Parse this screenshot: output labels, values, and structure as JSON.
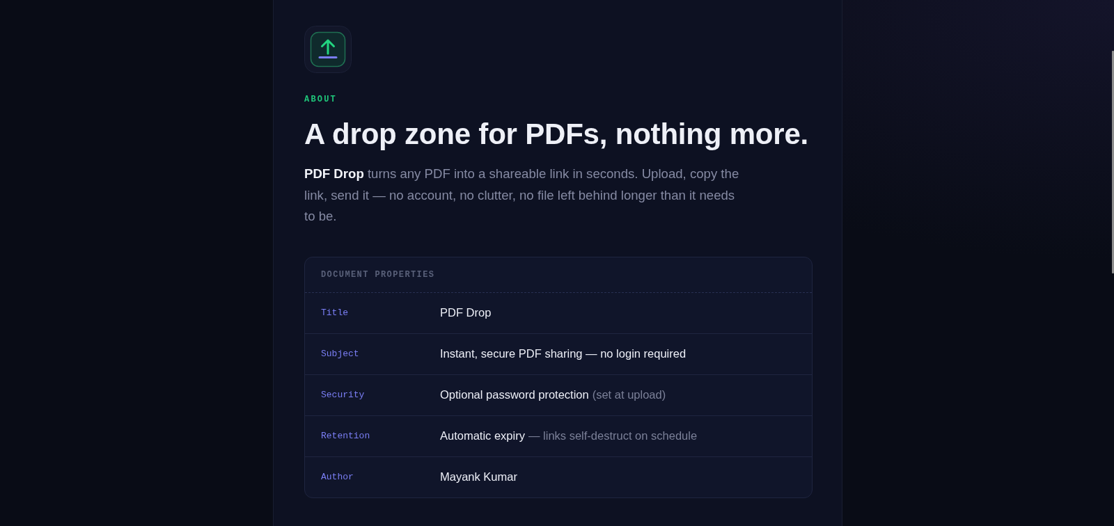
{
  "eyebrow": "ABOUT",
  "headline": "A drop zone for PDFs, nothing more.",
  "intro": "**PDF Drop** turns any PDF into a shareable link in seconds. Upload, copy the link, send it — no account, no clutter, no file left behind longer than it needs to be.",
  "properties": {
    "title": "DOCUMENT PROPERTIES",
    "rows": [
      {
        "key": "Title",
        "value": "PDF Drop"
      },
      {
        "key": "Subject",
        "value": "Instant, secure PDF sharing — no login required"
      },
      {
        "key": "Security",
        "value": "Optional password protection",
        "note": "(set at upload)"
      },
      {
        "key": "Retention",
        "value": "Automatic expiry",
        "note": "— links self-destruct on schedule"
      },
      {
        "key": "Author",
        "value": "Mayank Kumar"
      }
    ]
  }
}
